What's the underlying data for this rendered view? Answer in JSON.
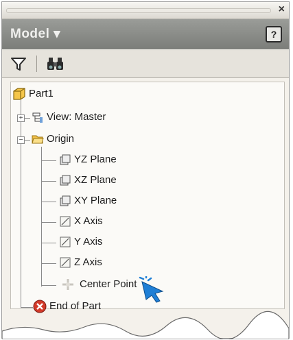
{
  "panel": {
    "title": "Model",
    "dropdown_arrow": "▾",
    "help_label": "?",
    "close_label": "×"
  },
  "toolbar": {
    "filter_icon": "filter-icon",
    "find_icon": "binoculars-icon"
  },
  "tree": {
    "part": "Part1",
    "view": "View: Master",
    "origin": "Origin",
    "yz_plane": "YZ Plane",
    "xz_plane": "XZ Plane",
    "xy_plane": "XY Plane",
    "x_axis": "X Axis",
    "y_axis": "Y Axis",
    "z_axis": "Z Axis",
    "center_point": "Center Point",
    "end_of_part": "End of Part"
  },
  "colors": {
    "header": "#8a8c88",
    "cursor": "#1f7fd6",
    "end_icon": "#d23a2a",
    "folder": "#f2c14a"
  }
}
